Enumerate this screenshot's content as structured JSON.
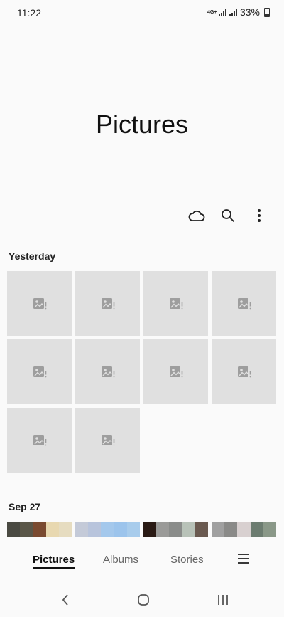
{
  "status_bar": {
    "time": "11:22",
    "network_type": "4G+",
    "battery_percent": "33%",
    "battery_level": 0.33
  },
  "header": {
    "title": "Pictures"
  },
  "toolbar": {
    "icons": [
      "cloud-icon",
      "search-icon",
      "more-options-icon"
    ]
  },
  "sections": [
    {
      "label": "Yesterday",
      "placeholder_count": 10,
      "placeholder_icon": "image-placeholder-icon"
    },
    {
      "label": "Sep 27"
    }
  ],
  "bottom_tabs": {
    "pictures": "Pictures",
    "albums": "Albums",
    "stories": "Stories",
    "selected": "Pictures"
  },
  "nav": {
    "icons": [
      "back-icon",
      "home-icon",
      "recents-icon"
    ]
  },
  "colors": {
    "background": "#fafafa",
    "placeholder": "#e0e0e0",
    "placeholder_icon": "#9e9e9e",
    "text": "#111111"
  }
}
